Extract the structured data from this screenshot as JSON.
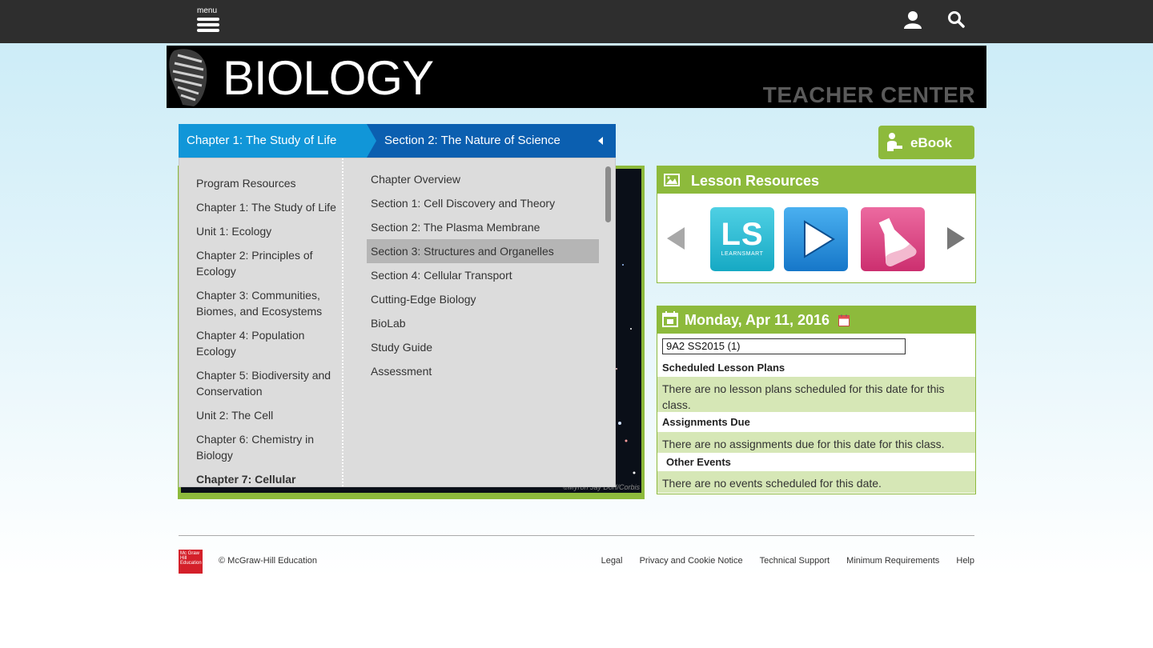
{
  "topbar": {
    "menu_label": "menu",
    "icons": [
      "user-icon",
      "search-icon"
    ]
  },
  "banner": {
    "title": "BIOLOGY",
    "subtitle": "TEACHER CENTER"
  },
  "breadcrumb": {
    "chapter": "Chapter 1: The Study of Life",
    "section": "Section 2: The Nature of Science"
  },
  "dropdown": {
    "left_items": [
      "Program Resources",
      "Chapter 1: The Study of Life",
      "Unit 1: Ecology",
      "Chapter 2: Principles of Ecology",
      "Chapter 3: Communities, Biomes, and Ecosystems",
      "Chapter 4: Population Ecology",
      "Chapter 5: Biodiversity and Conservation",
      "Unit 2: The Cell",
      "Chapter 6: Chemistry in Biology",
      "Chapter 7: Cellular"
    ],
    "right_items": [
      "Chapter Overview",
      "Section 1: Cell Discovery and Theory",
      "Section 2: The Plasma Membrane",
      "Section 3: Structures and Organelles",
      "Section 4: Cellular Transport",
      "Cutting-Edge Biology",
      "BioLab",
      "Study Guide",
      "Assessment"
    ],
    "selected_right": "Section 3: Structures and Organelles"
  },
  "hero": {
    "credit": "©Myron Jay Dorf/Corbis"
  },
  "ebook": {
    "label": "eBook"
  },
  "lesson_resources": {
    "title": "Lesson Resources",
    "tiles": [
      {
        "name": "learnsmart",
        "big": "LS",
        "small": "LEARNSMART"
      },
      {
        "name": "video"
      },
      {
        "name": "lab"
      }
    ]
  },
  "calendar": {
    "date": "Monday, Apr 11, 2016",
    "class_select": "9A2 SS2015 (1)",
    "scheduled_heading": "Scheduled Lesson Plans",
    "scheduled_text": "There are no lesson plans scheduled for this date for this class.",
    "assignments_heading": "Assignments Due",
    "assignments_text": "There are no assignments due for this date for this class.",
    "events_heading": "Other Events",
    "events_text": "There are no events scheduled for this date."
  },
  "footer": {
    "logo_text": "Mc Graw Hill Education",
    "copyright": "© McGraw-Hill Education",
    "links": [
      "Legal",
      "Privacy and Cookie Notice",
      "Technical Support",
      "Minimum Requirements",
      "Help"
    ]
  },
  "colors": {
    "topbar": "#2e2e2e",
    "chapter_crumb": "#1196d8",
    "section_crumb": "#0b5fb0",
    "accent_green": "#8dba3c",
    "row_green": "#d6e7b6",
    "brand_red": "#d4202a"
  }
}
